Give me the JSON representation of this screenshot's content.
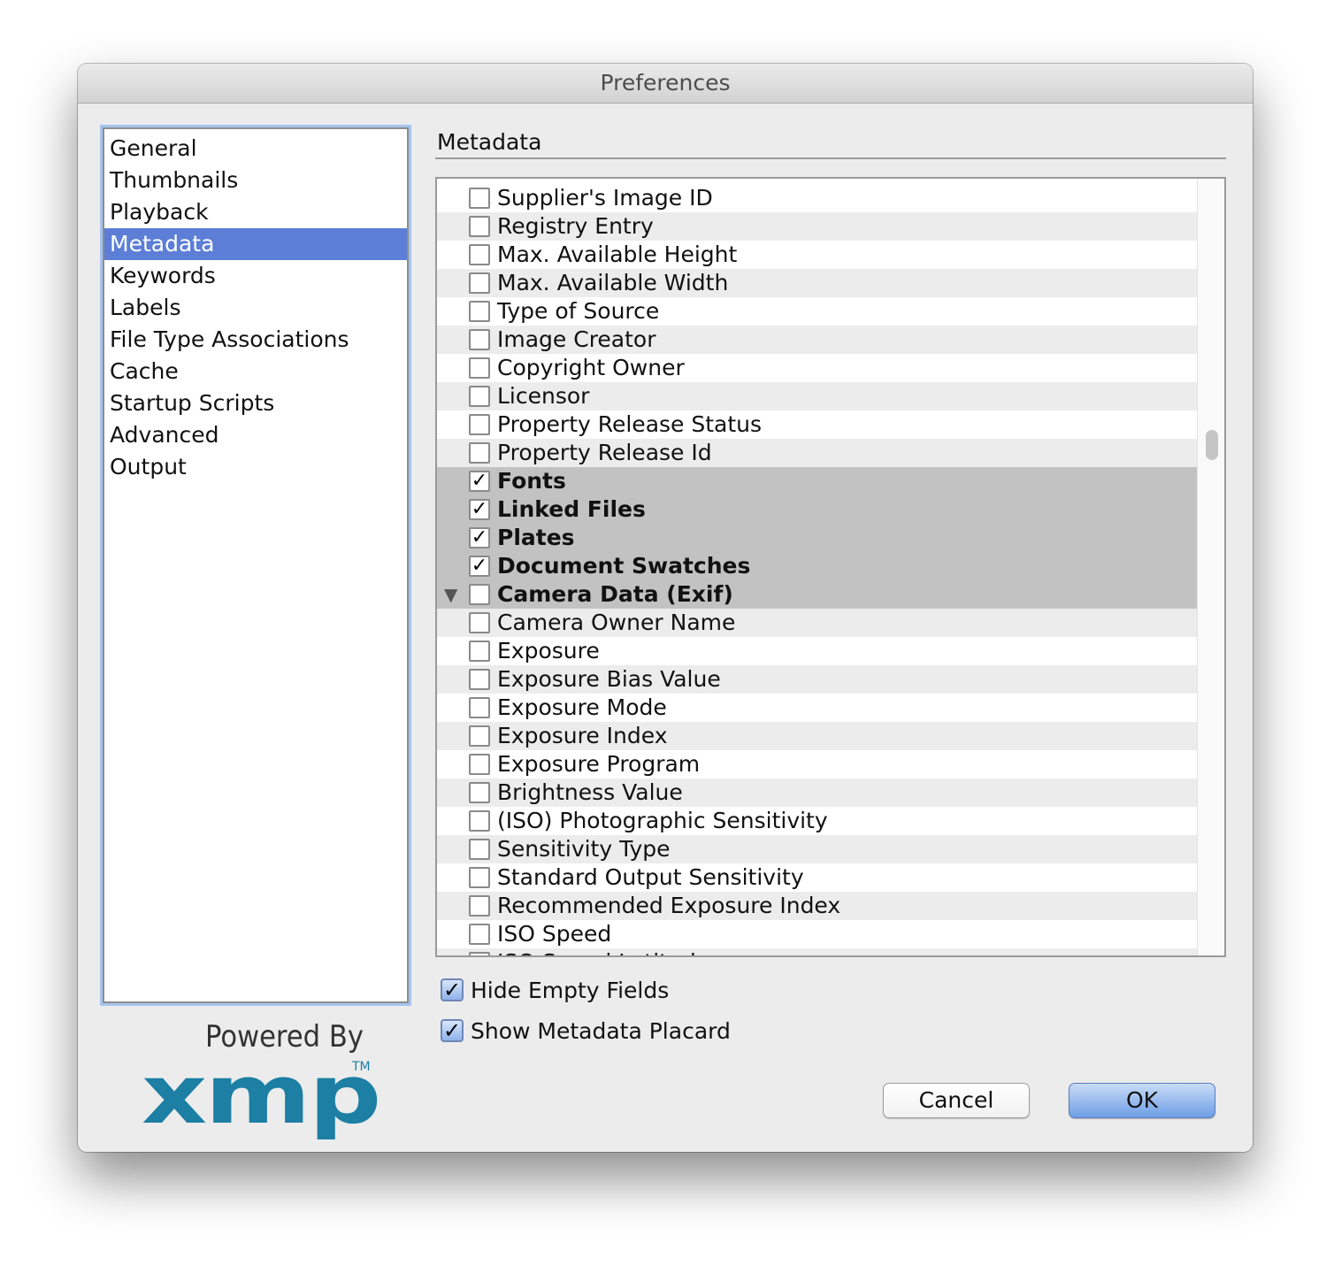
{
  "window": {
    "title": "Preferences"
  },
  "sidebar": {
    "items": [
      {
        "label": "General",
        "selected": false
      },
      {
        "label": "Thumbnails",
        "selected": false
      },
      {
        "label": "Playback",
        "selected": false
      },
      {
        "label": "Metadata",
        "selected": true
      },
      {
        "label": "Keywords",
        "selected": false
      },
      {
        "label": "Labels",
        "selected": false
      },
      {
        "label": "File Type Associations",
        "selected": false
      },
      {
        "label": "Cache",
        "selected": false
      },
      {
        "label": "Startup Scripts",
        "selected": false
      },
      {
        "label": "Advanced",
        "selected": false
      },
      {
        "label": "Output",
        "selected": false
      }
    ]
  },
  "panel": {
    "title": "Metadata",
    "rows": [
      {
        "label": "Supplier's Image ID",
        "checked": false,
        "category": false
      },
      {
        "label": "Registry Entry",
        "checked": false,
        "category": false
      },
      {
        "label": "Max. Available Height",
        "checked": false,
        "category": false
      },
      {
        "label": "Max. Available Width",
        "checked": false,
        "category": false
      },
      {
        "label": "Type of Source",
        "checked": false,
        "category": false
      },
      {
        "label": "Image Creator",
        "checked": false,
        "category": false
      },
      {
        "label": "Copyright Owner",
        "checked": false,
        "category": false
      },
      {
        "label": "Licensor",
        "checked": false,
        "category": false
      },
      {
        "label": "Property Release Status",
        "checked": false,
        "category": false
      },
      {
        "label": "Property Release Id",
        "checked": false,
        "category": false
      },
      {
        "label": "Fonts",
        "checked": true,
        "category": true
      },
      {
        "label": "Linked Files",
        "checked": true,
        "category": true
      },
      {
        "label": "Plates",
        "checked": true,
        "category": true
      },
      {
        "label": "Document Swatches",
        "checked": true,
        "category": true
      },
      {
        "label": "Camera Data (Exif)",
        "checked": false,
        "category": true,
        "expanded": true
      },
      {
        "label": "Camera Owner Name",
        "checked": false,
        "category": false
      },
      {
        "label": "Exposure",
        "checked": false,
        "category": false
      },
      {
        "label": "Exposure Bias Value",
        "checked": false,
        "category": false
      },
      {
        "label": "Exposure Mode",
        "checked": false,
        "category": false
      },
      {
        "label": "Exposure Index",
        "checked": false,
        "category": false
      },
      {
        "label": "Exposure Program",
        "checked": false,
        "category": false
      },
      {
        "label": "Brightness Value",
        "checked": false,
        "category": false
      },
      {
        "label": "(ISO) Photographic Sensitivity",
        "checked": false,
        "category": false
      },
      {
        "label": "Sensitivity Type",
        "checked": false,
        "category": false
      },
      {
        "label": "Standard Output Sensitivity",
        "checked": false,
        "category": false
      },
      {
        "label": "Recommended Exposure Index",
        "checked": false,
        "category": false
      },
      {
        "label": "ISO Speed",
        "checked": false,
        "category": false
      },
      {
        "label": "ISO Speed Latitude",
        "checked": false,
        "category": false
      }
    ]
  },
  "options": {
    "hide_empty": {
      "label": "Hide Empty Fields",
      "checked": true
    },
    "show_placard": {
      "label": "Show Metadata Placard",
      "checked": true
    }
  },
  "buttons": {
    "cancel": "Cancel",
    "ok": "OK"
  },
  "branding": {
    "powered_by": "Powered By",
    "logo": "xmp",
    "tm": "TM"
  },
  "glyphs": {
    "check": "✓",
    "triangle_down": "▼"
  },
  "colors": {
    "selection": "#5c7ed6",
    "category_row": "#c2c2c2",
    "xmp_logo": "#1c7fa3"
  }
}
